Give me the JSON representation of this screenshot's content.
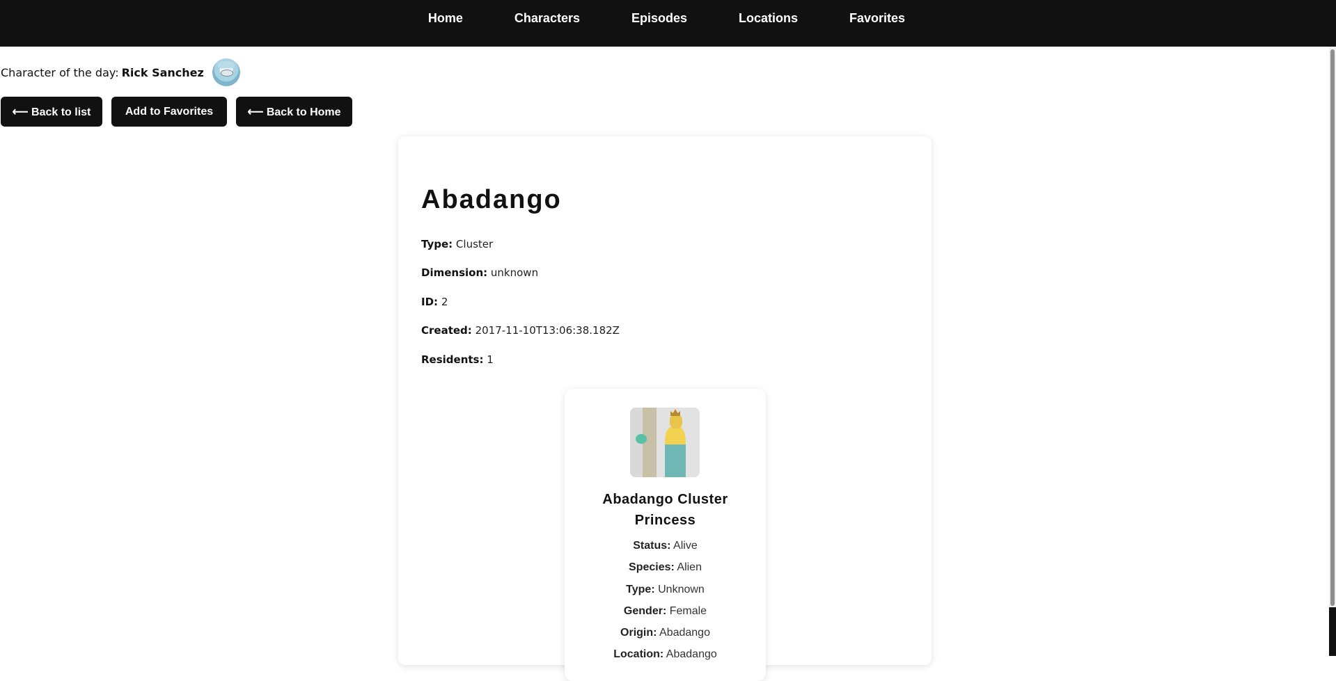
{
  "nav": {
    "items": [
      {
        "label": "Home"
      },
      {
        "label": "Characters"
      },
      {
        "label": "Episodes"
      },
      {
        "label": "Locations"
      },
      {
        "label": "Favorites"
      }
    ]
  },
  "character_of_day": {
    "label": "Character of the day:",
    "name": "Rick Sanchez"
  },
  "actions": {
    "back_to_list": "⟵ Back to list",
    "add_favorites": "Add to Favorites",
    "back_to_home": "⟵ Back to Home"
  },
  "location": {
    "name": "Abadango",
    "fields": [
      {
        "label": "Type:",
        "value": "Cluster"
      },
      {
        "label": "Dimension:",
        "value": "unknown"
      },
      {
        "label": "ID:",
        "value": "2"
      },
      {
        "label": "Created:",
        "value": "2017-11-10T13:06:38.182Z"
      },
      {
        "label": "Residents:",
        "value": "1"
      }
    ]
  },
  "resident": {
    "name": "Abadango Cluster Princess",
    "fields": [
      {
        "label": "Status:",
        "value": "Alive"
      },
      {
        "label": "Species:",
        "value": "Alien"
      },
      {
        "label": "Type:",
        "value": "Unknown"
      },
      {
        "label": "Gender:",
        "value": "Female"
      },
      {
        "label": "Origin:",
        "value": "Abadango"
      },
      {
        "label": "Location:",
        "value": "Abadango"
      }
    ]
  }
}
